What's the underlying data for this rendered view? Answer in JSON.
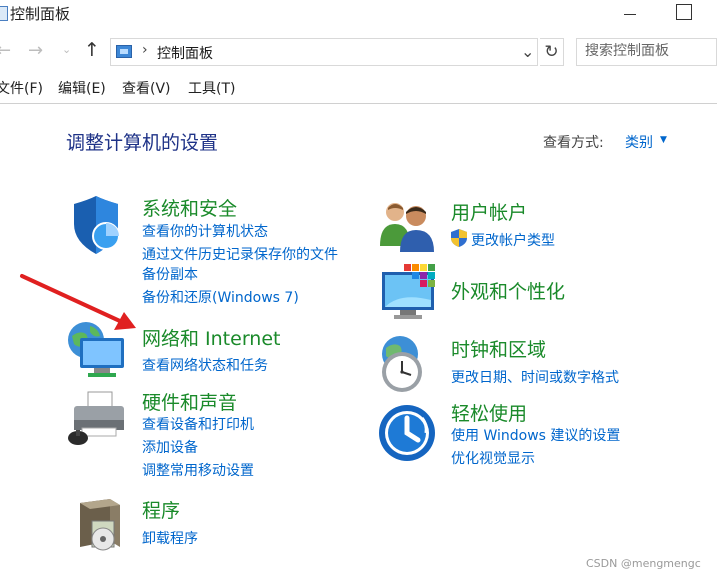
{
  "window": {
    "title": "控制面板"
  },
  "address": {
    "path": "控制面板",
    "separator": "›"
  },
  "search": {
    "placeholder": "搜索控制面板"
  },
  "menu": [
    "文件(F)",
    "编辑(E)",
    "查看(V)",
    "工具(T)"
  ],
  "main": {
    "title": "调整计算机的设置",
    "view_by_label": "查看方式:",
    "view_by_value": "类别"
  },
  "categories": [
    {
      "title": "系统和安全",
      "links": [
        "查看你的计算机状态",
        "通过文件历史记录保存你的文件",
        "备份副本",
        "备份和还原(Windows 7)"
      ]
    },
    {
      "title": "网络和 Internet",
      "links": [
        "查看网络状态和任务"
      ]
    },
    {
      "title": "硬件和声音",
      "links": [
        "查看设备和打印机",
        "添加设备",
        "调整常用移动设置"
      ]
    },
    {
      "title": "程序",
      "links": [
        "卸载程序"
      ]
    },
    {
      "title": "用户帐户",
      "links": [
        "更改帐户类型"
      ]
    },
    {
      "title": "外观和个性化",
      "links": []
    },
    {
      "title": "时钟和区域",
      "links": [
        "更改日期、时间或数字格式"
      ]
    },
    {
      "title": "轻松使用",
      "links": [
        "使用 Windows 建议的设置",
        "优化视觉显示"
      ]
    }
  ],
  "annotation": {
    "arrow_color": "#e02020"
  },
  "watermark": "CSDN @mengmengc",
  "colors": {
    "category_title": "#1a8a2a",
    "link": "#0066cc",
    "page_title": "#1e3287"
  }
}
